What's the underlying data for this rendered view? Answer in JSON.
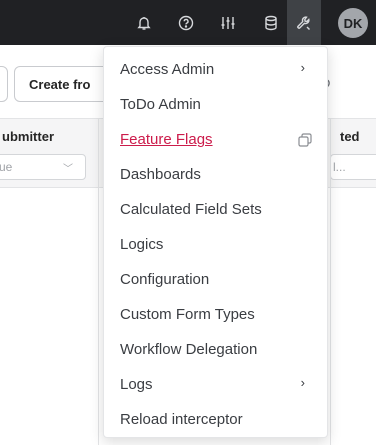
{
  "header": {
    "avatar_initials": "DK",
    "icons": [
      "bell-icon",
      "help-icon",
      "sliders-icon",
      "database-icon",
      "wrench-icon"
    ]
  },
  "background": {
    "create_button_label": "Create fro",
    "columns": [
      {
        "title": "ubmitter",
        "filter_value": "ue"
      },
      {
        "title": "ted",
        "filter_value": "l..."
      }
    ]
  },
  "menu": {
    "items": [
      {
        "label": "Access Admin",
        "has_submenu": true
      },
      {
        "label": "ToDo Admin"
      },
      {
        "label": "Feature Flags",
        "active": true,
        "has_copy_icon": true
      },
      {
        "label": "Dashboards"
      },
      {
        "label": "Calculated Field Sets"
      },
      {
        "label": "Logics"
      },
      {
        "label": "Configuration"
      },
      {
        "label": "Custom Form Types"
      },
      {
        "label": "Workflow Delegation"
      },
      {
        "label": "Logs",
        "has_submenu": true
      },
      {
        "label": "Reload interceptor"
      }
    ],
    "accent_color": "#cc1c4b"
  },
  "colors": {
    "topbar": "#202124",
    "active_icon_bg": "#3f4246"
  }
}
